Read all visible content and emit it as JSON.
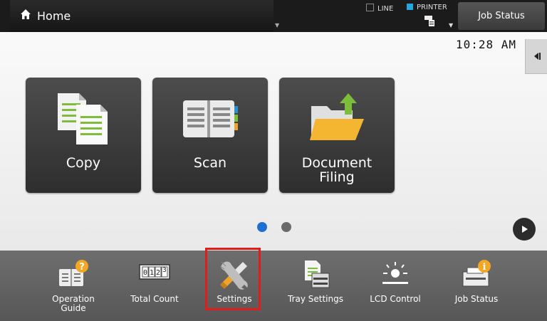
{
  "header": {
    "title": "Home",
    "status_line": "LINE",
    "status_printer": "PRINTER",
    "job_status_label": "Job Status"
  },
  "main": {
    "clock": "10:28 AM",
    "tiles": [
      {
        "label": "Copy"
      },
      {
        "label": "Scan"
      },
      {
        "label": "Document Filing"
      }
    ],
    "page_indicator": {
      "current": 1,
      "total": 2
    }
  },
  "bottom_bar": {
    "items": [
      {
        "label": "Operation Guide",
        "icon": "operation-guide-icon"
      },
      {
        "label": "Total Count",
        "icon": "counter-icon",
        "counter_text": "0 1 2 3"
      },
      {
        "label": "Settings",
        "icon": "wrench-screwdriver-icon",
        "highlighted": true
      },
      {
        "label": "Tray Settings",
        "icon": "tray-settings-icon"
      },
      {
        "label": "LCD Control",
        "icon": "lcd-brightness-icon"
      },
      {
        "label": "Job Status",
        "icon": "job-status-icon"
      }
    ]
  },
  "colors": {
    "accent": "#1f6fd1",
    "highlight": "#e21b1b",
    "line_indicator": "#1b1b1b",
    "printer_indicator": "#22a7e0",
    "badge": "#f5a623"
  }
}
